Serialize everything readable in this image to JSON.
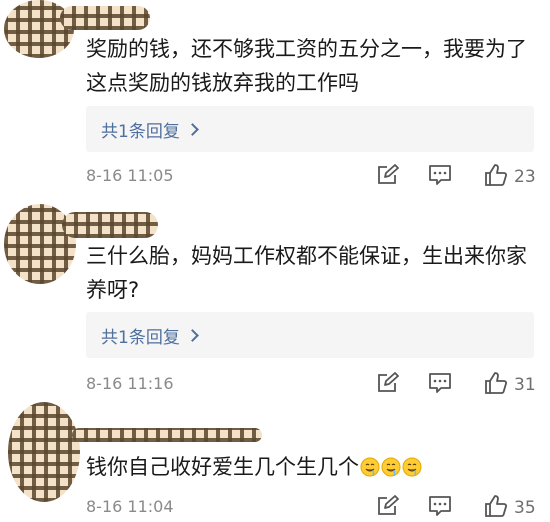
{
  "comments": [
    {
      "text": "奖励的钱，还不够我工资的五分之一，我要为了这点奖励的钱放弃我的工作吗",
      "reply_label": "共1条回复",
      "time": "8-16 11:05",
      "likes": "23"
    },
    {
      "text": "三什么胎，妈妈工作权都不能保证，生出来你家养呀?",
      "reply_label": "共1条回复",
      "time": "8-16 11:16",
      "likes": "31"
    },
    {
      "text": "钱你自己收好爱生几个生几个",
      "emojis": [
        "drooling-face-emoji",
        "drooling-face-emoji",
        "drooling-face-emoji"
      ],
      "time": "8-16 11:04",
      "likes": "35"
    }
  ],
  "icons": {
    "edit": "edit-icon",
    "comment": "comment-icon",
    "like": "thumbs-up-icon"
  },
  "colors": {
    "reply_link": "#4f6f9e",
    "meta_gray": "#8a8a8a",
    "reply_bg": "#f5f5f5"
  }
}
